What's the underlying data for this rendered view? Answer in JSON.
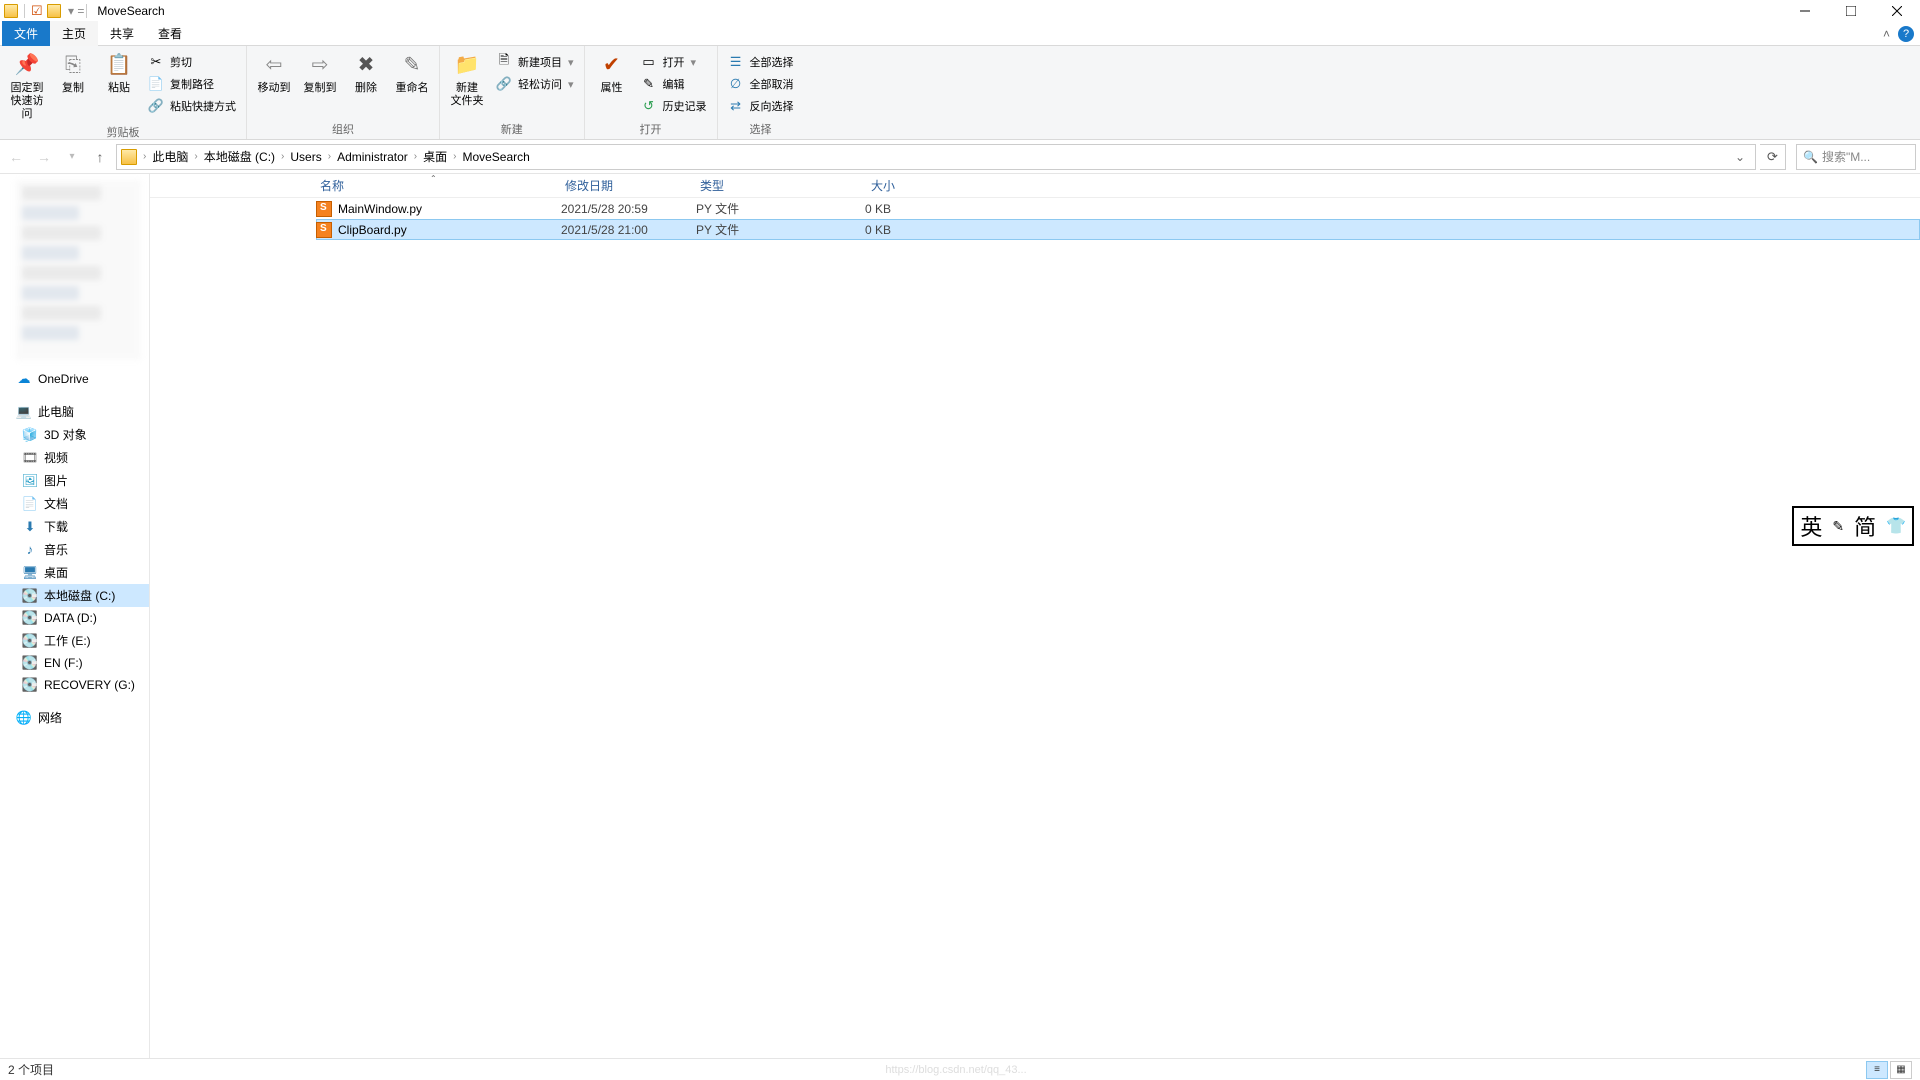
{
  "window": {
    "title": "MoveSearch"
  },
  "ribbon": {
    "tabs": {
      "file": "文件",
      "home": "主页",
      "share": "共享",
      "view": "查看"
    },
    "groups": {
      "clipboard": {
        "label": "剪贴板",
        "pin": "固定到\n快速访问",
        "copy": "复制",
        "paste": "粘贴",
        "cut": "剪切",
        "copypath": "复制路径",
        "pasteShortcut": "粘贴快捷方式"
      },
      "organize": {
        "label": "组织",
        "moveto": "移动到",
        "copyto": "复制到",
        "delete": "删除",
        "rename": "重命名"
      },
      "new": {
        "label": "新建",
        "newfolder": "新建\n文件夹",
        "newitem": "新建项目",
        "easyaccess": "轻松访问"
      },
      "open": {
        "label": "打开",
        "properties": "属性",
        "open": "打开",
        "edit": "编辑",
        "history": "历史记录"
      },
      "select": {
        "label": "选择",
        "selectall": "全部选择",
        "selectnone": "全部取消",
        "invert": "反向选择"
      }
    }
  },
  "breadcrumb": [
    "此电脑",
    "本地磁盘 (C:)",
    "Users",
    "Administrator",
    "桌面",
    "MoveSearch"
  ],
  "search": {
    "placeholder": "搜索\"M..."
  },
  "columns": {
    "name": "名称",
    "date": "修改日期",
    "type": "类型",
    "size": "大小"
  },
  "files": [
    {
      "name": "MainWindow.py",
      "date": "2021/5/28 20:59",
      "type": "PY 文件",
      "size": "0 KB",
      "selected": false
    },
    {
      "name": "ClipBoard.py",
      "date": "2021/5/28 21:00",
      "type": "PY 文件",
      "size": "0 KB",
      "selected": true
    }
  ],
  "nav": {
    "onedrive": "OneDrive",
    "thispc": "此电脑",
    "objects3d": "3D 对象",
    "videos": "视频",
    "pictures": "图片",
    "documents": "文档",
    "downloads": "下载",
    "music": "音乐",
    "desktop": "桌面",
    "cdrive": "本地磁盘 (C:)",
    "ddrive": "DATA (D:)",
    "edrive": "工作 (E:)",
    "fdrive": "EN (F:)",
    "gdrive": "RECOVERY (G:)",
    "network": "网络"
  },
  "status": {
    "items": "2 个项目"
  },
  "ime": {
    "left": "英",
    "mid": "简"
  },
  "watermark": "https://blog.csdn.net/qq_43..."
}
